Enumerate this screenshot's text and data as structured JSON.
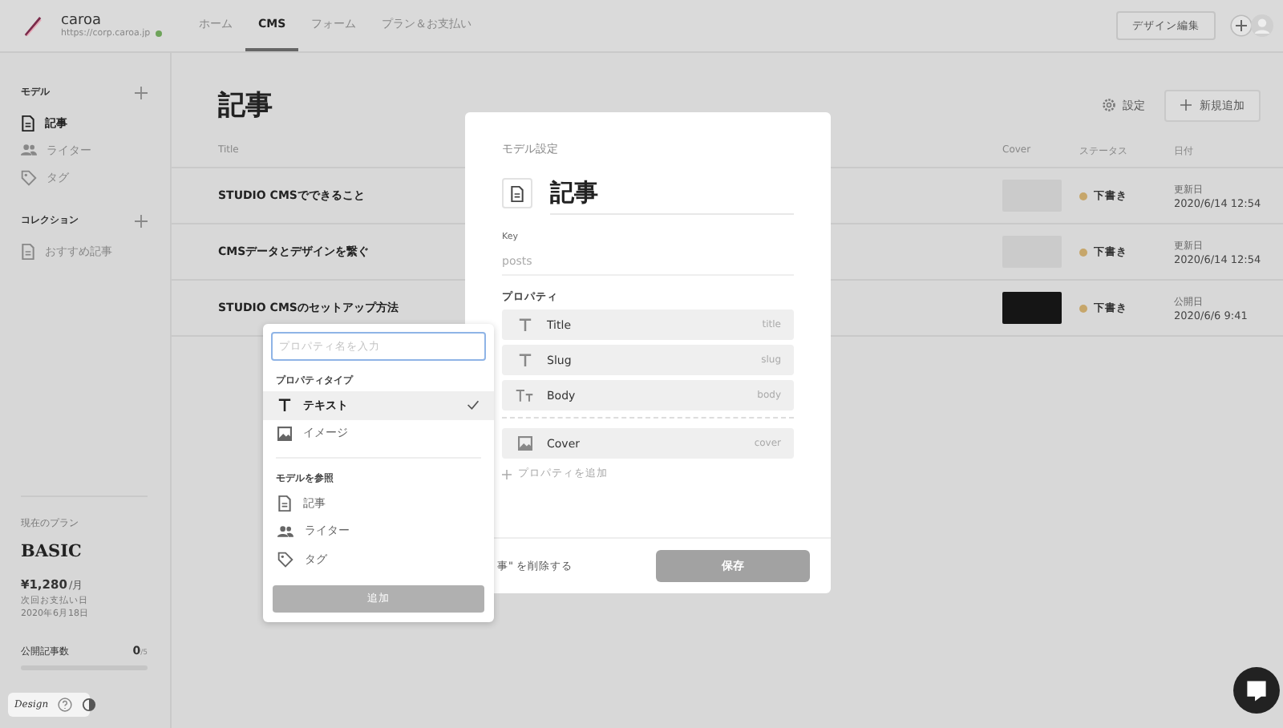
{
  "header": {
    "site_name": "caroa",
    "url": "https://corp.caroa.jp",
    "tabs": [
      {
        "label": "ホーム",
        "selected": false
      },
      {
        "label": "CMS",
        "selected": true
      },
      {
        "label": "フォーム",
        "selected": false
      },
      {
        "label": "プラン＆お支払い",
        "selected": false
      }
    ],
    "design_button": "デザイン編集"
  },
  "sidebar": {
    "sections": [
      {
        "heading": "モデル",
        "items": [
          {
            "label": "記事",
            "kind": "doc",
            "selected": true
          },
          {
            "label": "ライター",
            "kind": "people",
            "selected": false
          },
          {
            "label": "タグ",
            "kind": "tag",
            "selected": false
          }
        ]
      },
      {
        "heading": "コレクション",
        "items": [
          {
            "label": "おすすめ記事",
            "kind": "doc",
            "selected": false
          }
        ]
      }
    ],
    "plan": {
      "label": "現在のプラン",
      "name": "BASIC",
      "price": "¥1,280",
      "unit": "/月",
      "next_label": "次回お支払い日",
      "next_date": "2020年6月18日",
      "published_label": "公開記事数",
      "count": "0",
      "limit": "/5",
      "level": 0
    },
    "footer": {
      "logo": "Design"
    }
  },
  "main": {
    "title": "記事",
    "settings": "設定",
    "add_button": "新規追加",
    "columns": [
      "Title",
      "Cover",
      "ステータス",
      "日付"
    ],
    "rows": [
      {
        "title": "STUDIO CMSでできること",
        "kind": "blank",
        "status": "下書き",
        "color": "#c6a66a",
        "date_label": "更新日",
        "date": "2020/6/14 12:54"
      },
      {
        "title": "CMSデータとデザインを繋ぐ",
        "kind": "blank",
        "status": "下書き",
        "color": "#c6a66a",
        "date_label": "更新日",
        "date": "2020/6/14 12:54"
      },
      {
        "title": "STUDIO CMSのセットアップ方法",
        "kind": "photo",
        "status": "下書き",
        "color": "#c6a66a",
        "date_label": "公開日",
        "date": "2020/6/6 9:41"
      }
    ]
  },
  "modal": {
    "heading": "モデル設定",
    "name": "記事",
    "key_label": "Key",
    "key": "posts",
    "properties_label": "プロパティ",
    "groups": [
      [
        {
          "name": "Title",
          "key": "title",
          "kind": "text"
        },
        {
          "name": "Slug",
          "key": "slug",
          "kind": "text"
        },
        {
          "name": "Body",
          "key": "body",
          "kind": "richtext"
        }
      ],
      [
        {
          "name": "Cover",
          "key": "cover",
          "kind": "image"
        }
      ]
    ],
    "add_property": "プロパティを追加",
    "delete": "事\" を削除する",
    "save": "保存"
  },
  "dropdown": {
    "placeholder": "プロパティ名を入力",
    "types_label": "プロパティタイプ",
    "types": [
      {
        "label": "テキスト",
        "kind": "text",
        "selected": true
      },
      {
        "label": "イメージ",
        "kind": "image",
        "selected": false
      }
    ],
    "refs_label": "モデルを参照",
    "refs": [
      {
        "label": "記事",
        "kind": "doc"
      },
      {
        "label": "ライター",
        "kind": "people"
      },
      {
        "label": "タグ",
        "kind": "tag"
      }
    ],
    "add_button": "追加",
    "disabled": true
  }
}
